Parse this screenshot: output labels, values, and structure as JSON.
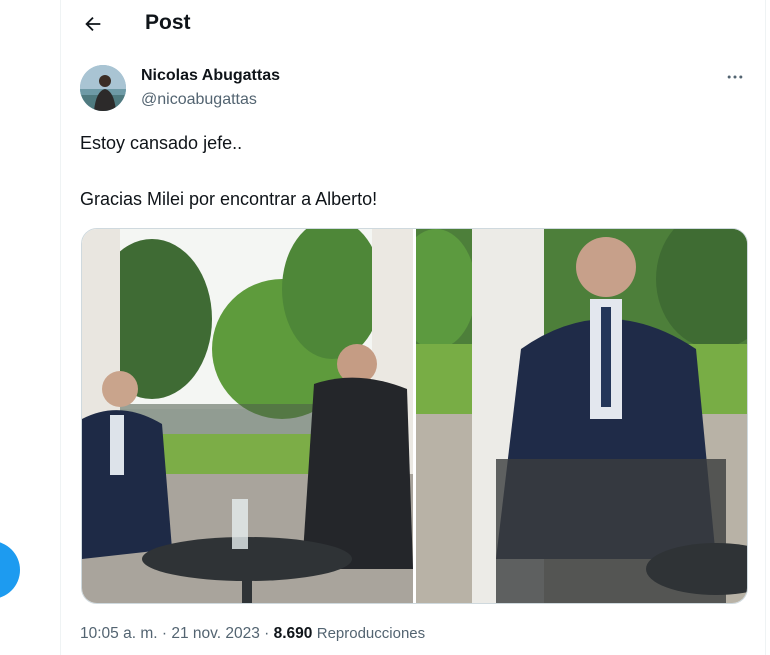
{
  "header": {
    "title": "Post"
  },
  "tweet": {
    "author_name": "Nicolas Abugattas",
    "handle": "@nicoabugattas",
    "text_lines": [
      "Estoy cansado jefe..",
      "Gracias Milei por encontrar a Alberto!"
    ],
    "time": "10:05 a. m.",
    "date": "21 nov. 2023",
    "separator": "·",
    "views_count": "8.690",
    "views_label": "Reproducciones",
    "media_count": 2
  },
  "colors": {
    "accent": "#1d9bf0",
    "text": "#0f1419",
    "secondary": "#536471",
    "border": "#eff3f4"
  },
  "icons": {
    "back": "arrow-left-icon",
    "more": "more-horizontal-icon",
    "compose": "compose-button"
  }
}
